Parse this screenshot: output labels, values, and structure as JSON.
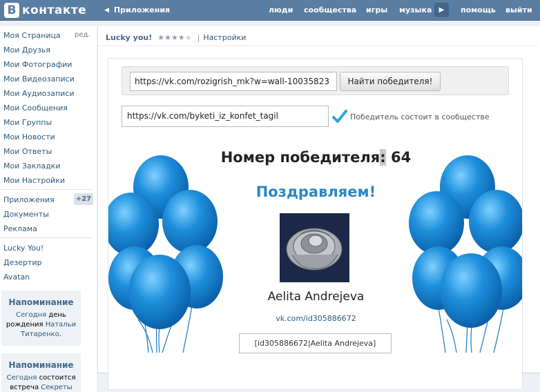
{
  "header": {
    "logo_letter": "В",
    "logo_text": "контакте",
    "back_chevron": "◀",
    "section": "Приложения",
    "nav": [
      "люди",
      "сообщества",
      "игры",
      "музыка",
      "помощь",
      "выйти"
    ],
    "more_icon": "▶"
  },
  "sidebar": {
    "edit_label": "ред.",
    "items": [
      "Моя Страница",
      "Мои Друзья",
      "Мои Фотографии",
      "Мои Видеозаписи",
      "Мои Аудиозаписи",
      "Мои Сообщения",
      "Мои Группы",
      "Мои Новости",
      "Мои Ответы",
      "Мои Закладки",
      "Мои Настройки"
    ],
    "items2": [
      "Приложения",
      "Документы",
      "Реклама"
    ],
    "apps_badge": "+27",
    "items3": [
      "Lucky You!",
      "Дезертир",
      "Avatan"
    ],
    "reminders": [
      {
        "title": "Напоминание",
        "t1": "Сегодня",
        "t2": " день",
        "t3": "рождения ",
        "t4": "Натальи",
        "t5": "Титаренко",
        "t6": "."
      },
      {
        "title": "Напоминание",
        "t1": "Сегодня",
        "t2": " состоится",
        "t3": "встреча ",
        "t4": "Секреты"
      }
    ]
  },
  "app": {
    "name": "Lucky you!",
    "rating": 4,
    "rating_max": 5,
    "stars_on": "★★★★",
    "stars_off": "★",
    "pipe": "|",
    "settings": "Настройки",
    "post_url": "https://vk.com/rozigrish_mk?w=wall-10035823",
    "find_button": "Найти победителя!",
    "group_url": "https://vk.com/byketi_iz_konfet_tagil",
    "member_check": "Победитель состоит в сообществе",
    "winner_label": "Номер победителя",
    "winner_colon": ":",
    "winner_number": "64",
    "congrats": "Поздравляем!",
    "winner_name": "Aelita Andrejeva",
    "winner_link": "vk.com/id305886672",
    "winner_code": "[id305886672|Aelita Andrejeva]"
  },
  "colors": {
    "header": "#597da3",
    "link": "#2b587a",
    "congrats": "#2a88c0",
    "balloon": "#1e8fdc",
    "check": "#2aa7e0"
  }
}
